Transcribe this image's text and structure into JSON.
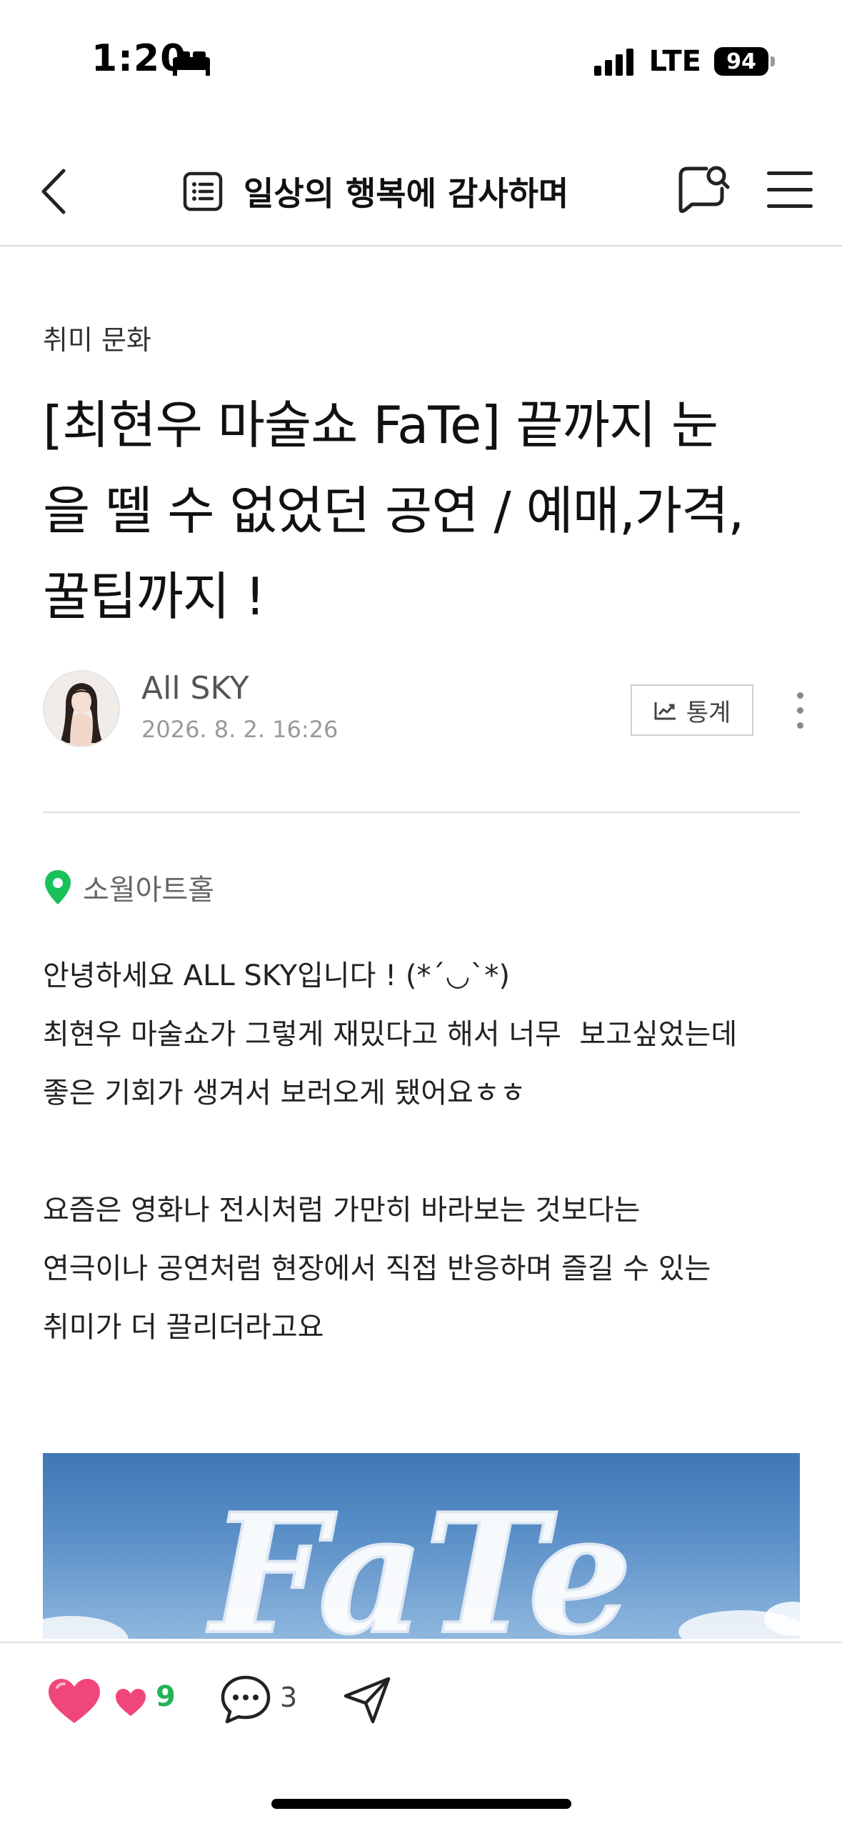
{
  "status_bar": {
    "time": "1:20",
    "network": "LTE",
    "battery": "94"
  },
  "header": {
    "title": "일상의 행복에 감사하며"
  },
  "article": {
    "category": "취미 문화",
    "title": "[최현우 마술쇼 FaTe] 끝까지 눈을 뗄 수 없었던 공연 / 예매,가격, 꿀팁까지 !",
    "title_lines": [
      "[최현우 마술쇼 FaTe] 끝까지 눈",
      "을 뗄 수 없었던 공연 / 예매,가격,",
      "꿀팁까지 !"
    ],
    "author": "All SKY",
    "date": "2026. 8. 2. 16:26",
    "stats_label": "통계",
    "location": "소월아트홀",
    "body_lines": [
      "안녕하세요 ALL SKY입니다 ! (*´◡`*)",
      "최현우 마술쇼가 그렇게 재밌다고 해서 너무  보고싶었는데",
      "좋은 기회가 생겨서 보러오게 됐어요ㅎㅎ",
      "",
      "요즘은 영화나 전시처럼 가만히 바라보는 것보다는",
      "연극이나 공연처럼 현장에서 직접 반응하며 즐길 수 있는",
      "취미가 더 끌리더라고요"
    ],
    "poster_text": "FaTe"
  },
  "bottom_bar": {
    "like_count": "9",
    "comment_count": "3"
  },
  "colors": {
    "like_pink": "#f0467a",
    "like_count_green": "#22b455",
    "location_green": "#19c15a"
  }
}
